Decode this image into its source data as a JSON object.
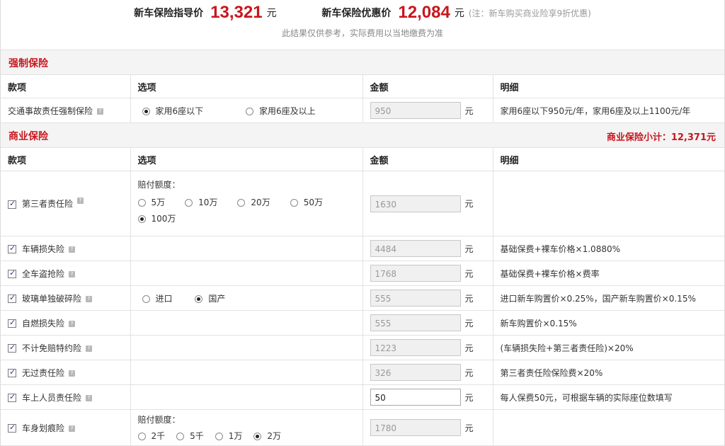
{
  "header": {
    "guide_label": "新车保险指导价",
    "guide_value": "13,321",
    "guide_unit": "元",
    "discount_label": "新车保险优惠价",
    "discount_value": "12,084",
    "discount_unit": "元",
    "discount_note": "(注：新车购买商业险享9折优惠)",
    "disclaimer": "此结果仅供参考，实际费用以当地缴费为准"
  },
  "columns": {
    "item": "款项",
    "options": "选项",
    "amount": "金额",
    "detail": "明细"
  },
  "mandatory": {
    "title": "强制保险",
    "rows": [
      {
        "name": "交通事故责任强制保险",
        "options": [
          {
            "label": "家用6座以下",
            "selected": true
          },
          {
            "label": "家用6座及以上",
            "selected": false
          }
        ],
        "amount": "950",
        "unit": "元",
        "detail": "家用6座以下950元/年，家用6座及以上1100元/年"
      }
    ]
  },
  "commercial": {
    "title": "商业保险",
    "subtotal": "商业保险小计：12,371元",
    "third_party": {
      "name": "第三者责任险",
      "option_label": "赔付额度：",
      "options": [
        {
          "label": "5万",
          "selected": false
        },
        {
          "label": "10万",
          "selected": false
        },
        {
          "label": "20万",
          "selected": false
        },
        {
          "label": "50万",
          "selected": false
        },
        {
          "label": "100万",
          "selected": true
        }
      ],
      "amount": "1630",
      "unit": "元",
      "detail": ""
    },
    "vehicle_damage": {
      "name": "车辆损失险",
      "amount": "4484",
      "unit": "元",
      "detail": "基础保费+裸车价格×1.0880%"
    },
    "theft": {
      "name": "全车盗抢险",
      "amount": "1768",
      "unit": "元",
      "detail": "基础保费+裸车价格×费率"
    },
    "glass": {
      "name": "玻璃单独破碎险",
      "options": [
        {
          "label": "进口",
          "selected": false
        },
        {
          "label": "国产",
          "selected": true
        }
      ],
      "amount": "555",
      "unit": "元",
      "detail": "进口新车购置价×0.25%，国产新车购置价×0.15%"
    },
    "self_ignition": {
      "name": "自燃损失险",
      "amount": "555",
      "unit": "元",
      "detail": "新车购置价×0.15%"
    },
    "no_deductible": {
      "name": "不计免赔特约险",
      "amount": "1223",
      "unit": "元",
      "detail": "(车辆损失险+第三者责任险)×20%"
    },
    "no_fault": {
      "name": "无过责任险",
      "amount": "326",
      "unit": "元",
      "detail": "第三者责任险保险费×20%"
    },
    "passenger": {
      "name": "车上人员责任险",
      "amount": "50",
      "unit": "元",
      "detail": "每人保费50元，可根据车辆的实际座位数填写"
    },
    "scratch": {
      "name": "车身划痕险",
      "option_label": "赔付额度：",
      "options": [
        {
          "label": "2千",
          "selected": false
        },
        {
          "label": "5千",
          "selected": false
        },
        {
          "label": "1万",
          "selected": false
        },
        {
          "label": "2万",
          "selected": true
        }
      ],
      "amount": "1780",
      "unit": "元",
      "detail": ""
    }
  },
  "help_glyph": "?"
}
